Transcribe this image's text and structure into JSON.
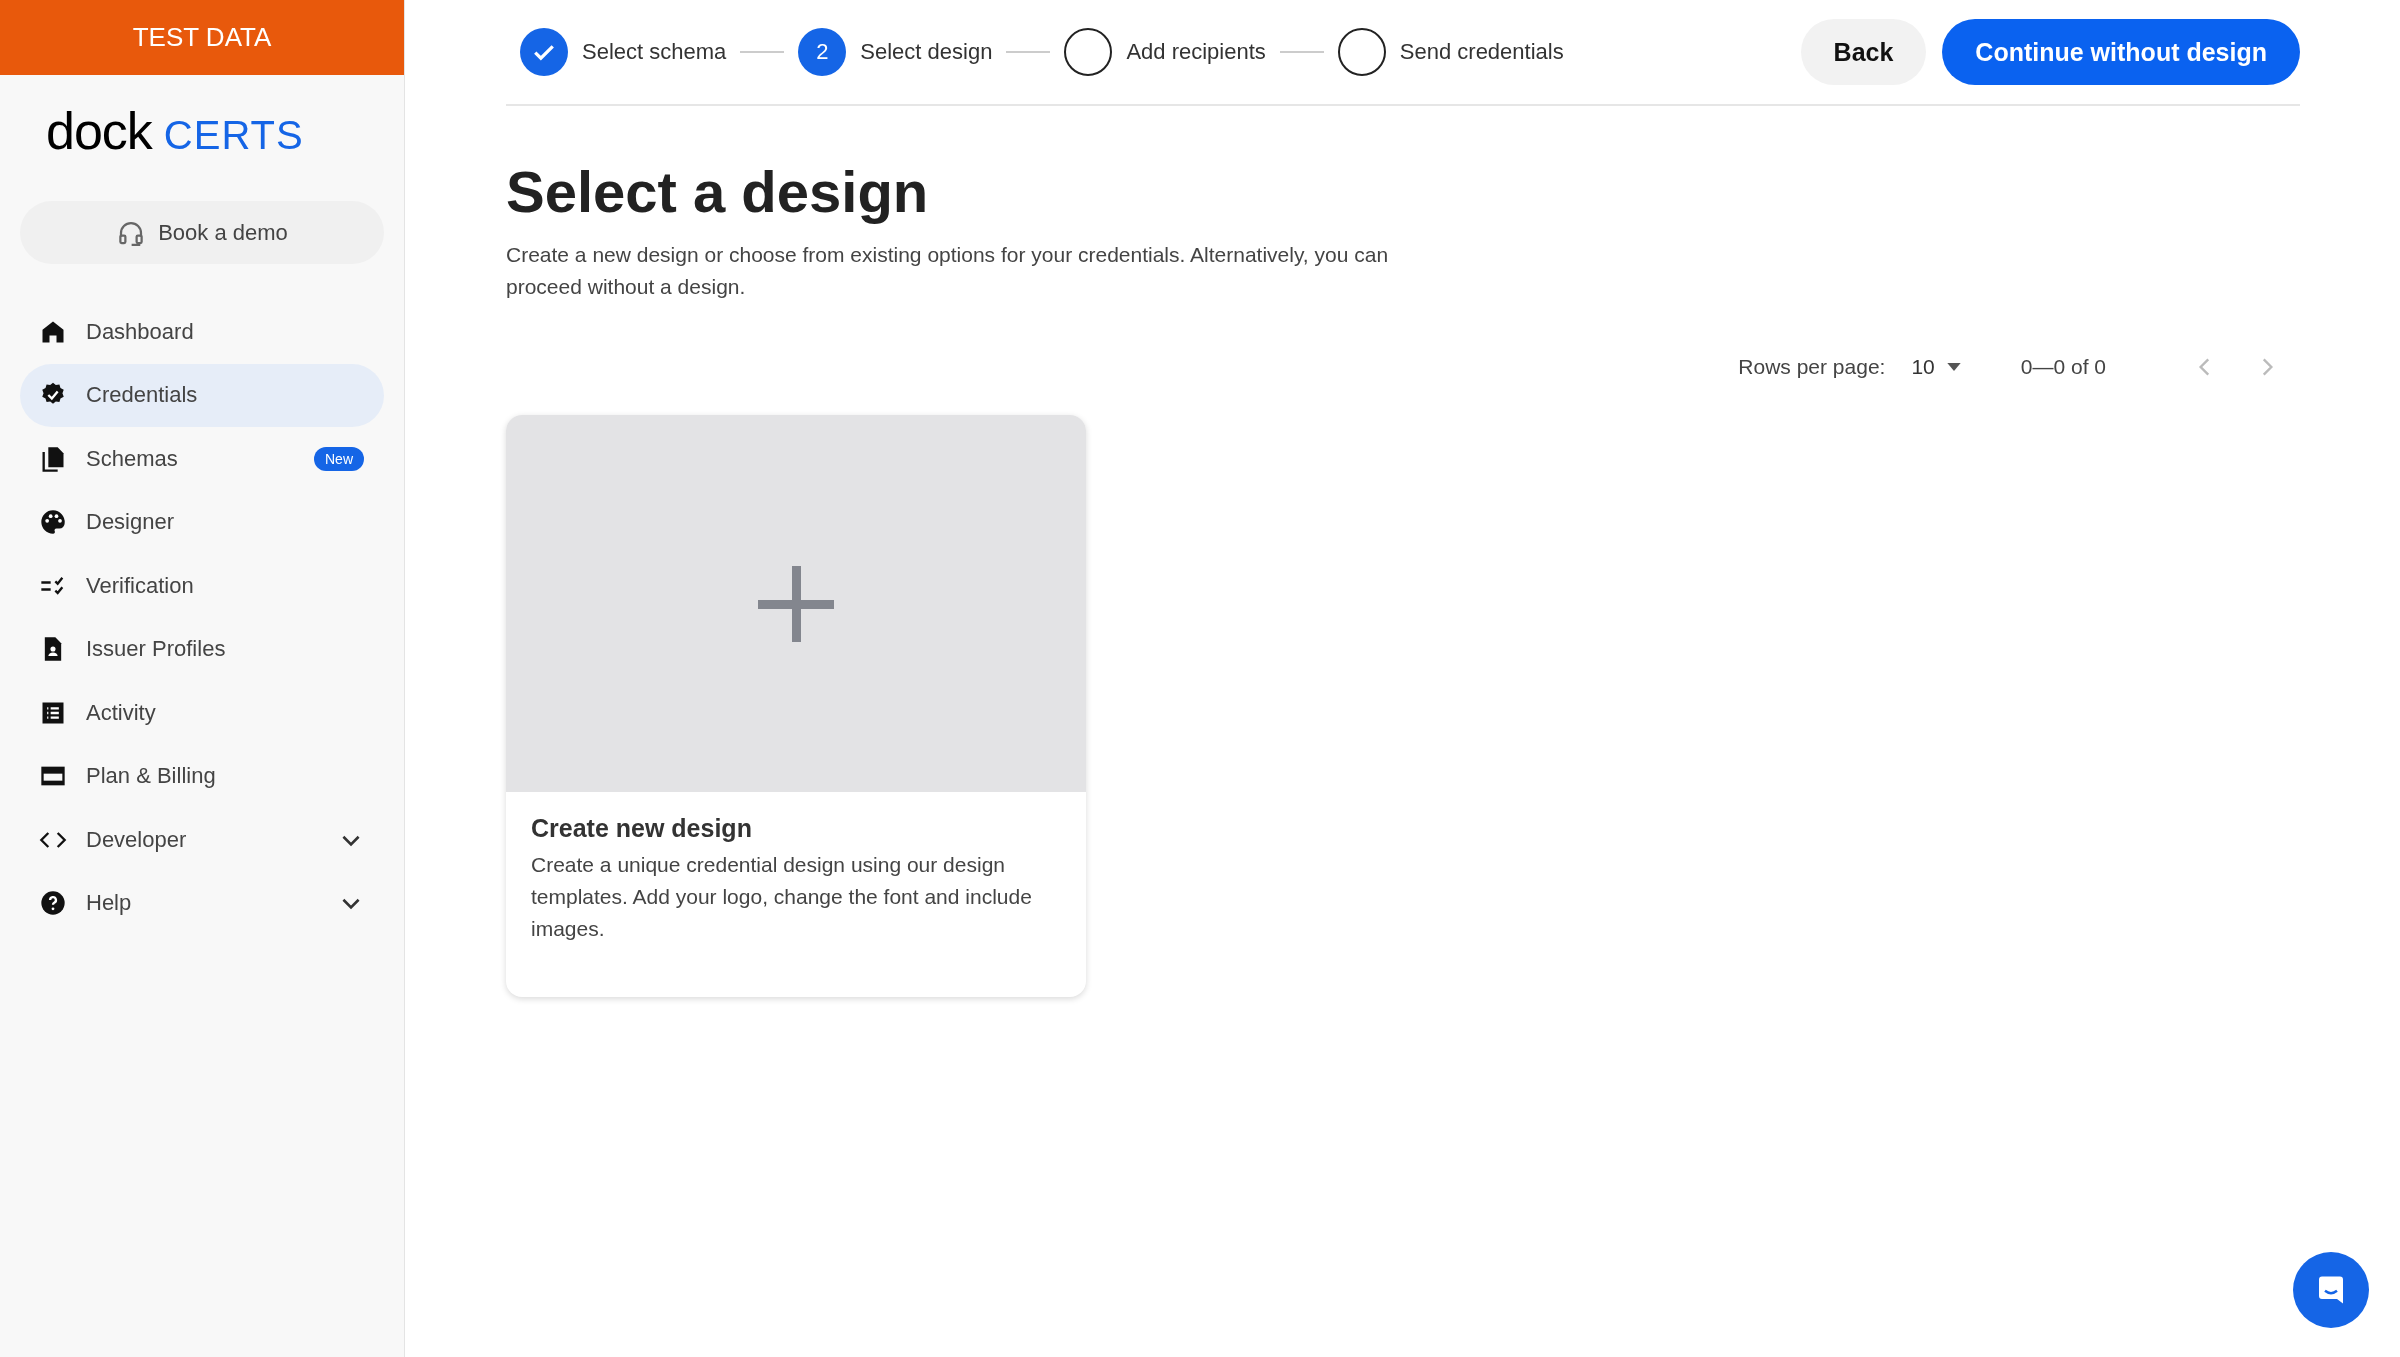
{
  "banner": {
    "text": "TEST DATA"
  },
  "logo": {
    "wordmark": "dock",
    "product": "CERTS"
  },
  "book_demo": {
    "label": "Book a demo"
  },
  "sidebar": {
    "items": [
      {
        "label": "Dashboard",
        "selected": false
      },
      {
        "label": "Credentials",
        "selected": true
      },
      {
        "label": "Schemas",
        "selected": false,
        "badge": "New"
      },
      {
        "label": "Designer",
        "selected": false
      },
      {
        "label": "Verification",
        "selected": false
      },
      {
        "label": "Issuer Profiles",
        "selected": false
      },
      {
        "label": "Activity",
        "selected": false
      },
      {
        "label": "Plan & Billing",
        "selected": false
      },
      {
        "label": "Developer",
        "selected": false,
        "expanded": false
      },
      {
        "label": "Help",
        "selected": false,
        "expanded": false
      }
    ]
  },
  "stepper": {
    "steps": [
      {
        "label": "Select schema",
        "kind": "done"
      },
      {
        "label": "Select design",
        "kind": "active",
        "number": "2"
      },
      {
        "label": "Add recipients",
        "kind": "pending"
      },
      {
        "label": "Send credentials",
        "kind": "pending"
      }
    ]
  },
  "actions": {
    "back": "Back",
    "primary": "Continue without design"
  },
  "page": {
    "title": "Select a design",
    "description": "Create a new design or choose from existing options for your credentials. Alternatively, you can proceed without a design."
  },
  "pagination": {
    "rows_label": "Rows per page:",
    "rows_value": "10",
    "range": "0—0 of 0",
    "prev_disabled": true,
    "next_disabled": true
  },
  "cards": [
    {
      "title": "Create new design",
      "description": "Create a unique credential design using our design templates. Add your logo, change the font and include images."
    }
  ]
}
